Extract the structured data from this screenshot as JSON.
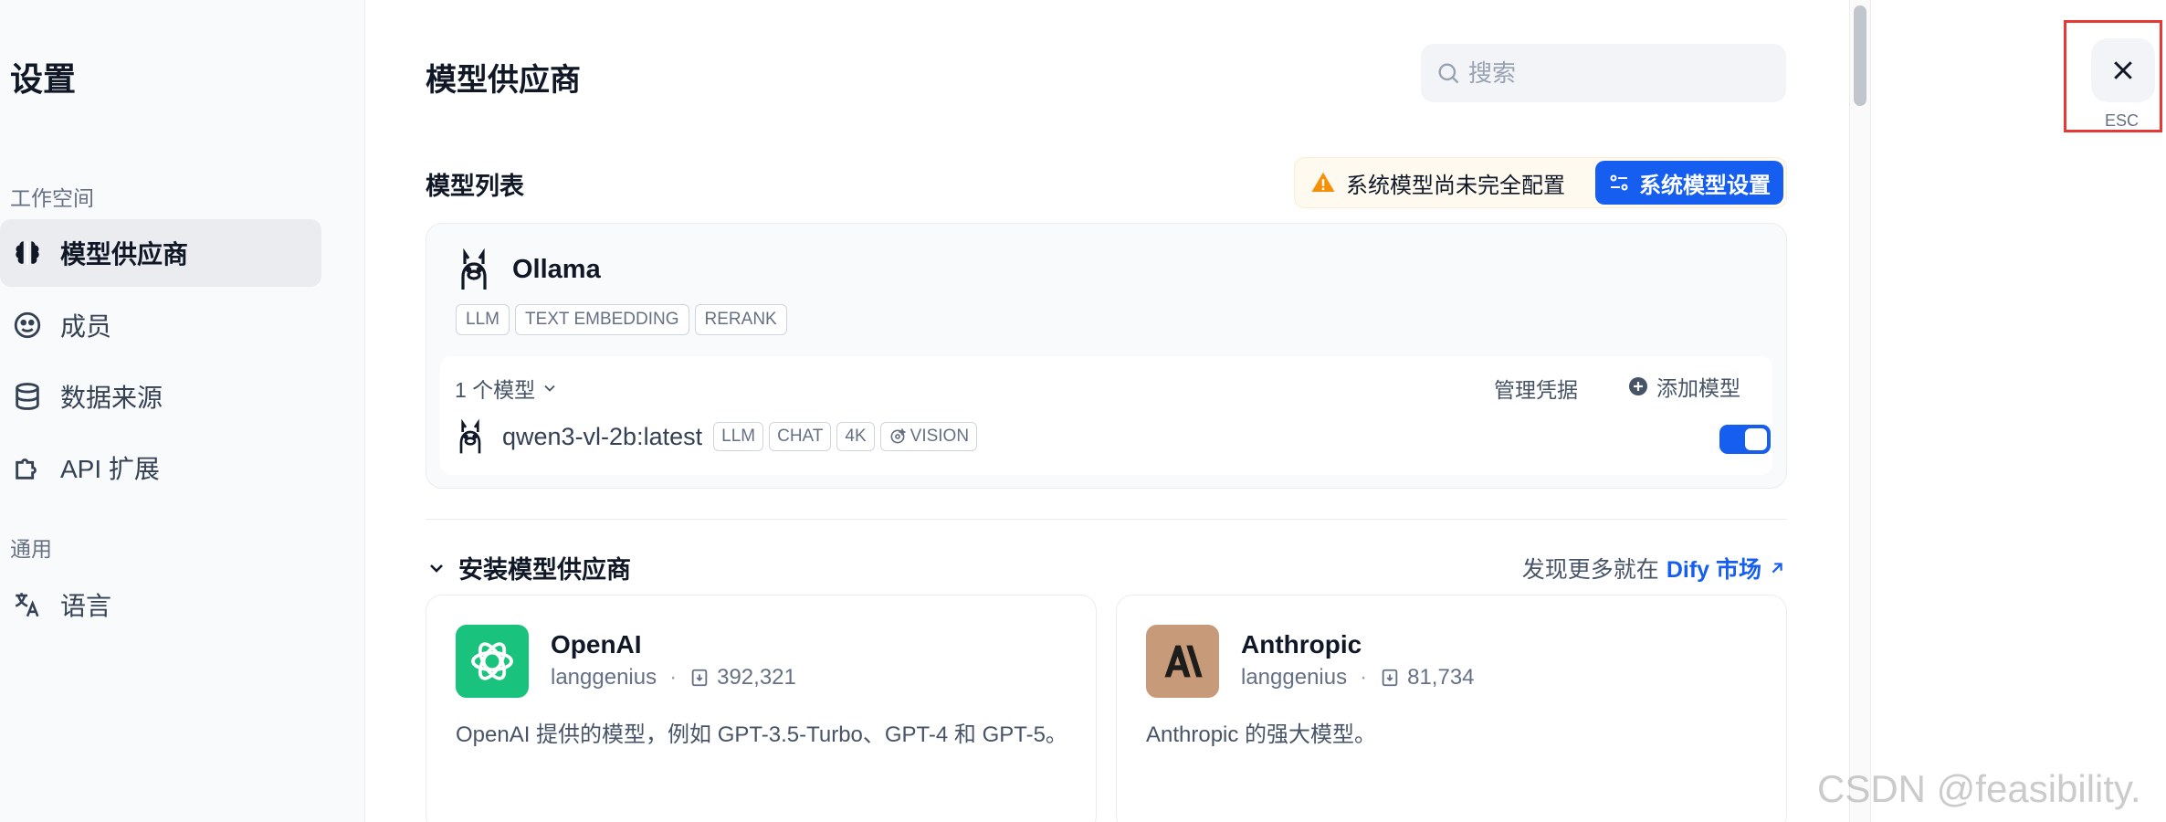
{
  "sidebar": {
    "title": "设置",
    "workspace_label": "工作空间",
    "items": [
      {
        "label": "模型供应商",
        "icon": "brain-icon",
        "active": true
      },
      {
        "label": "成员",
        "icon": "members-icon"
      },
      {
        "label": "数据来源",
        "icon": "database-icon"
      },
      {
        "label": "API 扩展",
        "icon": "puzzle-icon"
      }
    ],
    "general_label": "通用",
    "general_items": [
      {
        "label": "语言",
        "icon": "translate-icon"
      }
    ]
  },
  "main": {
    "title": "模型供应商",
    "search_placeholder": "搜索",
    "model_list_title": "模型列表",
    "warning_text": "系统模型尚未完全配置",
    "system_model_button": "系统模型设置",
    "provider": {
      "name": "Ollama",
      "tags": [
        "LLM",
        "TEXT EMBEDDING",
        "RERANK"
      ],
      "model_count": "1 个模型",
      "manage_credentials": "管理凭据",
      "add_model": "添加模型",
      "model": {
        "name": "qwen3-vl-2b:latest",
        "tags": [
          "LLM",
          "CHAT",
          "4K",
          "VISION"
        ],
        "enabled": true
      }
    },
    "install_title": "安装模型供应商",
    "market_prefix": "发现更多就在",
    "market_link": "Dify 市场",
    "cards": [
      {
        "name": "OpenAI",
        "author": "langgenius",
        "installs": "392,321",
        "description": "OpenAI 提供的模型，例如 GPT-3.5-Turbo、GPT-4 和 GPT-5。",
        "logo_color": "#19c37d"
      },
      {
        "name": "Anthropic",
        "author": "langgenius",
        "installs": "81,734",
        "description": "Anthropic 的强大模型。",
        "logo_color": "#c79a7a"
      }
    ]
  },
  "close": {
    "esc_label": "ESC"
  },
  "watermark": "CSDN @feasibility.",
  "colors": {
    "accent": "#155eef",
    "warning": "#f79009",
    "highlight": "#e53935"
  }
}
